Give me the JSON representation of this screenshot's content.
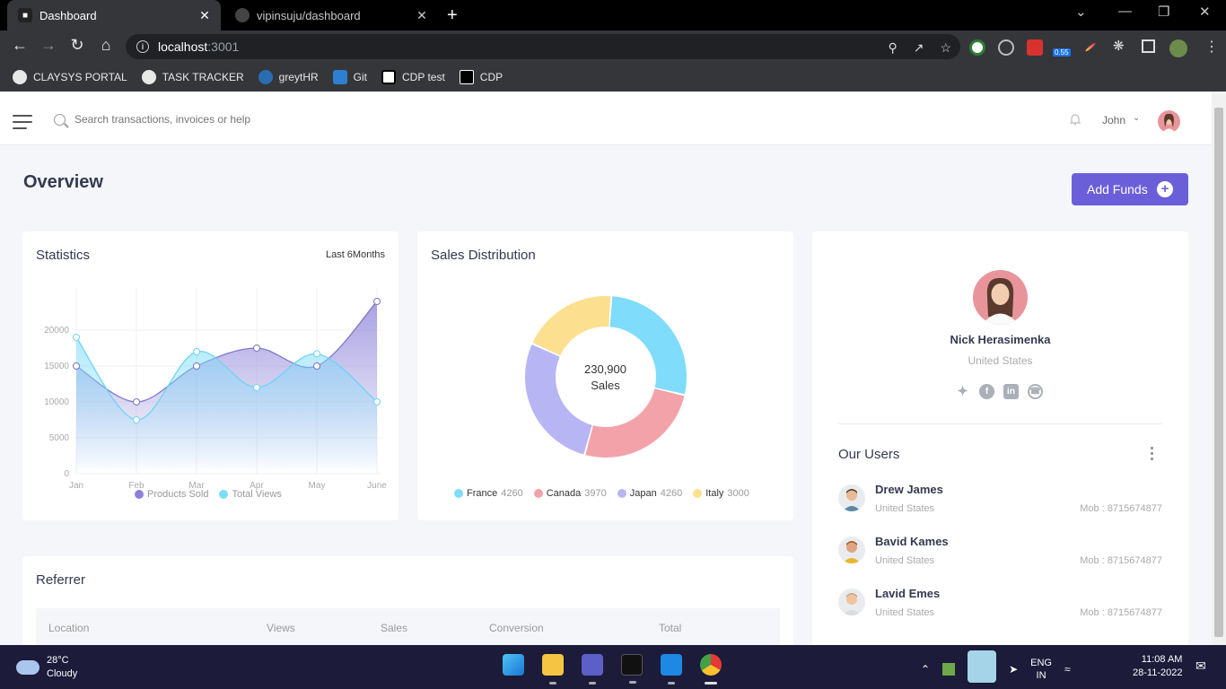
{
  "browser": {
    "tabs": [
      {
        "title": "Dashboard",
        "active": true,
        "icon": "dashboard-favicon"
      },
      {
        "title": "vipinsuju/dashboard",
        "active": false,
        "icon": "github-icon"
      }
    ],
    "address": {
      "host": "localhost",
      "port": ":3001"
    },
    "extension_badge": "0.55",
    "bookmarks": [
      {
        "label": "CLAYSYS PORTAL",
        "icon": "globe-icon"
      },
      {
        "label": "TASK TRACKER",
        "icon": "globe-icon"
      },
      {
        "label": "greytHR",
        "icon": "cloud-icon"
      },
      {
        "label": "Git",
        "icon": "azure-devops-icon"
      },
      {
        "label": "CDP test",
        "icon": "page-icon"
      },
      {
        "label": "CDP",
        "icon": "terminal-icon"
      }
    ]
  },
  "header": {
    "search_placeholder": "Search transactions, invoices or help",
    "user_name": "John"
  },
  "page": {
    "title": "Overview",
    "add_funds_label": "Add Funds"
  },
  "statistics": {
    "title": "Statistics",
    "range": "Last 6Months",
    "legend": [
      {
        "label": "Products Sold",
        "color": "#8c82d9"
      },
      {
        "label": "Total Views",
        "color": "#7ddcfa"
      }
    ]
  },
  "sales_distribution": {
    "title": "Sales Distribution",
    "center_value": "230,900",
    "center_label": "Sales",
    "legend": [
      {
        "label": "France",
        "value": "4260",
        "color": "#7fdcfa"
      },
      {
        "label": "Canada",
        "value": "3970",
        "color": "#f3a2a9"
      },
      {
        "label": "Japan",
        "value": "4260",
        "color": "#b8b5f5"
      },
      {
        "label": "Italy",
        "value": "3000",
        "color": "#fde08f"
      }
    ]
  },
  "chart_data": [
    {
      "type": "line",
      "title": "Statistics",
      "categories": [
        "Jan",
        "Feb",
        "Mar",
        "Apr",
        "May",
        "June"
      ],
      "yticks": [
        0,
        5000,
        10000,
        15000,
        20000
      ],
      "ylim": [
        0,
        25000
      ],
      "series": [
        {
          "name": "Products Sold",
          "values": [
            15000,
            10000,
            15000,
            17500,
            15000,
            24000
          ],
          "color": "#8c82d9"
        },
        {
          "name": "Total Views",
          "values": [
            19000,
            7500,
            17000,
            12000,
            16700,
            10000
          ],
          "color": "#7ddcfa"
        }
      ]
    },
    {
      "type": "pie",
      "title": "Sales Distribution",
      "categories": [
        "France",
        "Canada",
        "Japan",
        "Italy"
      ],
      "values": [
        4260,
        3970,
        4260,
        3000
      ],
      "colors": [
        "#7fdcfa",
        "#f3a2a9",
        "#b8b5f5",
        "#fde08f"
      ]
    }
  ],
  "profile": {
    "name": "Nick Herasimenka",
    "country": "United States",
    "socials": [
      "twitter-icon",
      "facebook-icon",
      "linkedin-icon",
      "whatsapp-icon"
    ]
  },
  "our_users": {
    "title": "Our Users",
    "users": [
      {
        "name": "Drew James",
        "country": "United States",
        "mobile": "Mob : 8715674877"
      },
      {
        "name": "Bavid Kames",
        "country": "United States",
        "mobile": "Mob : 8715674877"
      },
      {
        "name": "Lavid Emes",
        "country": "United States",
        "mobile": "Mob : 8715674877"
      }
    ]
  },
  "referrer": {
    "title": "Referrer",
    "columns": [
      "Location",
      "Views",
      "Sales",
      "Conversion",
      "Total"
    ]
  },
  "taskbar": {
    "temp": "28°C",
    "weather": "Cloudy",
    "lang1": "ENG",
    "lang2": "IN",
    "time": "11:08 AM",
    "date": "28-11-2022"
  }
}
